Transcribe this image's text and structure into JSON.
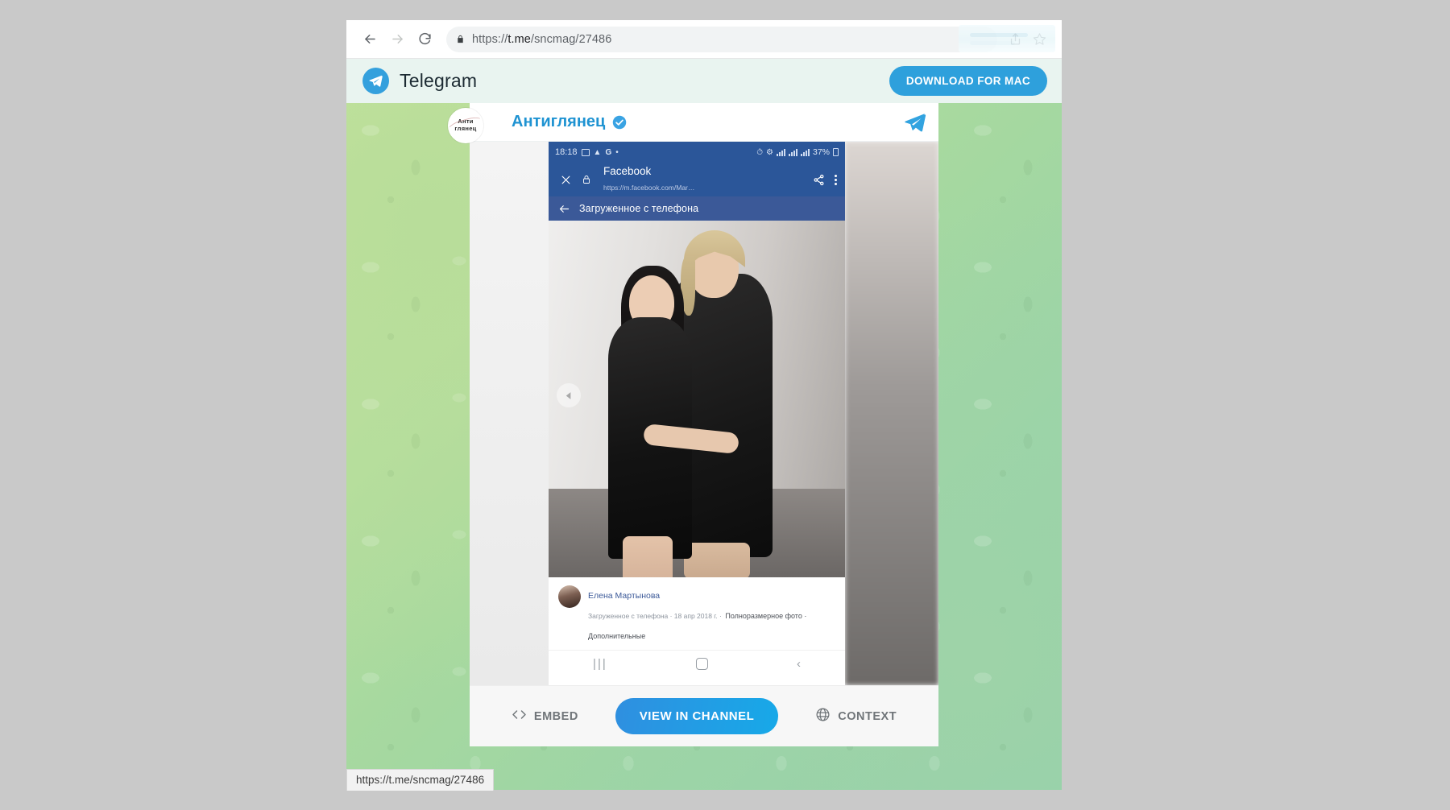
{
  "browser": {
    "back_label": "Back",
    "forward_label": "Forward",
    "reload_label": "Reload",
    "url_scheme": "https://",
    "url_host": "t.me",
    "url_path": "/sncmag/27486",
    "url_full": "https://t.me/sncmag/27486",
    "share_label": "Share",
    "bookmark_label": "Bookmark"
  },
  "status_bubble": {
    "link": "https://t.me/sncmag/27486"
  },
  "telegram_header": {
    "logo_icon": "telegram-plane-icon",
    "wordmark": "Telegram",
    "download_label": "DOWNLOAD FOR MAC"
  },
  "post": {
    "avatar": {
      "line1": "Анти",
      "line2": "глянец"
    },
    "channel_name": "Антиглянец",
    "verified_icon": "verified-check-icon",
    "send_icon": "telegram-plane-icon"
  },
  "phone_screenshot": {
    "status_bar": {
      "time": "18:18",
      "left_icons": [
        "screenshot-icon",
        "download-icon",
        "google-icon",
        "dot-icon"
      ],
      "right_icons": [
        "alarm-icon",
        "vibrate-icon",
        "sim1-icon",
        "sim2-icon",
        "signal-icon"
      ],
      "battery": "37%"
    },
    "custom_tab": {
      "close_icon": "close-icon",
      "lock_icon": "lock-icon",
      "title": "Facebook",
      "url": "https://m.facebook.com/Mar…",
      "share_icon": "share-icon",
      "menu_icon": "overflow-menu-icon"
    },
    "album_bar": {
      "back_icon": "arrow-left-icon",
      "title": "Загруженное с телефона"
    },
    "photo": {
      "prev_icon": "prev-arrow-icon",
      "alt": "Двое людей в чёрном позируют на сером фоне"
    },
    "caption": {
      "author": "Елена Мартынова",
      "meta": "Загруженное с телефона · 18 апр 2018 г. ·",
      "links": "Полноразмерное фото · Дополнительные"
    },
    "nav_bar": {
      "recents_icon": "recents-icon",
      "home_icon": "home-icon",
      "back_icon": "back-icon"
    }
  },
  "footer": {
    "embed_icon": "code-brackets-icon",
    "embed_label": "EMBED",
    "view_label": "VIEW IN CHANNEL",
    "context_icon": "globe-icon",
    "context_label": "CONTEXT"
  },
  "colors": {
    "telegram_blue": "#2ea0dc",
    "link_blue": "#1f93d2",
    "facebook_blue": "#3b5998",
    "cct_blue": "#2b5699",
    "page_green": "#a7d99f"
  }
}
